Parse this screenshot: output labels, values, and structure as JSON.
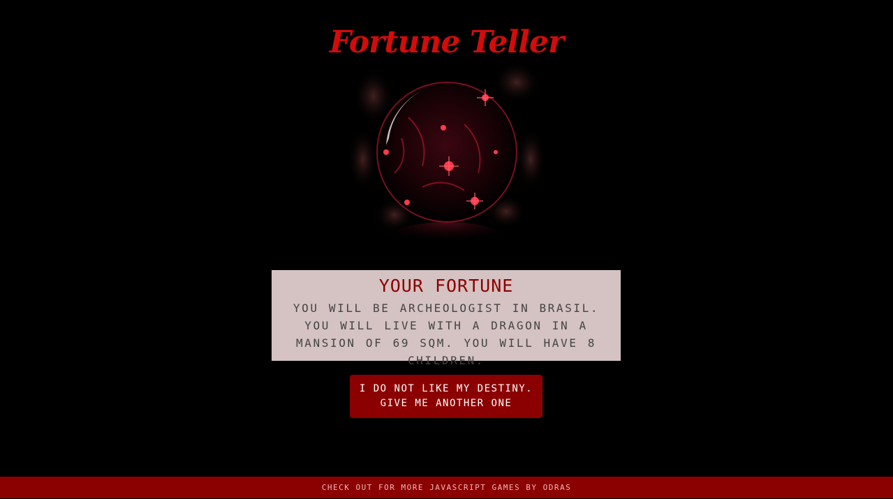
{
  "header": {
    "title": "Fortune Teller"
  },
  "orb": {
    "icon": "crystal-ball-icon",
    "colors": {
      "glow": "#ff2a3c",
      "dark": "#1a0206"
    }
  },
  "fortune": {
    "heading": "YOUR FORTUNE",
    "text": "YOU WILL BE ARCHEOLOGIST IN BRASIL. YOU WILL LIVE WITH A DRAGON IN A MANSION OF 69 SQM. YOU WILL HAVE 8 CHILDREN."
  },
  "actions": {
    "again_label": "I DO NOT LIKE MY DESTINY. GIVE ME ANOTHER ONE"
  },
  "footer": {
    "link_text": "CHECK OUT FOR MORE JAVASCRIPT GAMES BY ODRAS"
  },
  "colors": {
    "background": "#000000",
    "accent": "#8b0000",
    "title": "#d40b0b",
    "card": "#d5c2c2"
  }
}
